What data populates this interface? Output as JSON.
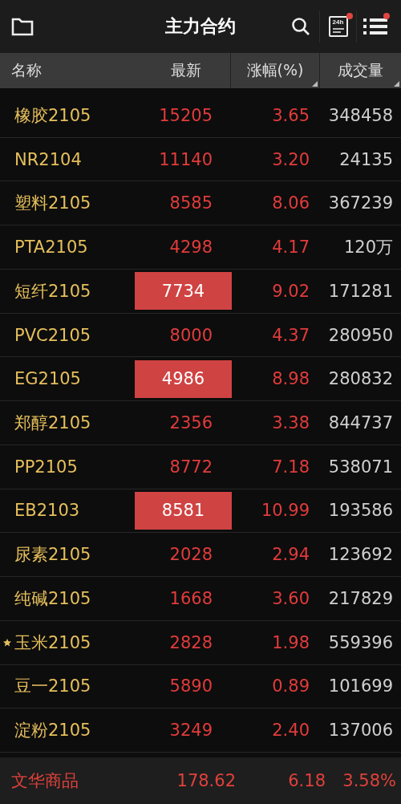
{
  "top_bar": {
    "title": "主力合约",
    "actions": [
      {
        "kind": "search",
        "badge": false
      },
      {
        "kind": "news",
        "label": "24h",
        "badge": true
      },
      {
        "kind": "menu",
        "badge": true
      }
    ]
  },
  "columns": [
    {
      "label": "名称",
      "sortable": false
    },
    {
      "label": "最新",
      "sortable": false
    },
    {
      "label": "涨幅(%)",
      "sortable": true
    },
    {
      "label": "成交量",
      "sortable": true
    }
  ],
  "rows": [
    {
      "name": "橡胶2105",
      "starred": false,
      "price": "15205",
      "highlighted": false,
      "change": "3.65",
      "volume": "348458"
    },
    {
      "name": "NR2104",
      "starred": false,
      "price": "11140",
      "highlighted": false,
      "change": "3.20",
      "volume": "24135"
    },
    {
      "name": "塑料2105",
      "starred": false,
      "price": "8585",
      "highlighted": false,
      "change": "8.06",
      "volume": "367239"
    },
    {
      "name": "PTA2105",
      "starred": false,
      "price": "4298",
      "highlighted": false,
      "change": "4.17",
      "volume": "120万"
    },
    {
      "name": "短纤2105",
      "starred": false,
      "price": "7734",
      "highlighted": true,
      "change": "9.02",
      "volume": "171281"
    },
    {
      "name": "PVC2105",
      "starred": false,
      "price": "8000",
      "highlighted": false,
      "change": "4.37",
      "volume": "280950"
    },
    {
      "name": "EG2105",
      "starred": false,
      "price": "4986",
      "highlighted": true,
      "change": "8.98",
      "volume": "280832"
    },
    {
      "name": "郑醇2105",
      "starred": false,
      "price": "2356",
      "highlighted": false,
      "change": "3.38",
      "volume": "844737"
    },
    {
      "name": "PP2105",
      "starred": false,
      "price": "8772",
      "highlighted": false,
      "change": "7.18",
      "volume": "538071"
    },
    {
      "name": "EB2103",
      "starred": false,
      "price": "8581",
      "highlighted": true,
      "change": "10.99",
      "volume": "193586"
    },
    {
      "name": "尿素2105",
      "starred": false,
      "price": "2028",
      "highlighted": false,
      "change": "2.94",
      "volume": "123692"
    },
    {
      "name": "纯碱2105",
      "starred": false,
      "price": "1668",
      "highlighted": false,
      "change": "3.60",
      "volume": "217829"
    },
    {
      "name": "玉米2105",
      "starred": true,
      "price": "2828",
      "highlighted": false,
      "change": "1.98",
      "volume": "559396"
    },
    {
      "name": "豆一2105",
      "starred": false,
      "price": "5890",
      "highlighted": false,
      "change": "0.89",
      "volume": "101699"
    },
    {
      "name": "淀粉2105",
      "starred": false,
      "price": "3249",
      "highlighted": false,
      "change": "2.40",
      "volume": "137006"
    }
  ],
  "index_bar": {
    "name": "文华商品",
    "value": "178.62",
    "change": "6.18",
    "percent": "3.58%"
  }
}
